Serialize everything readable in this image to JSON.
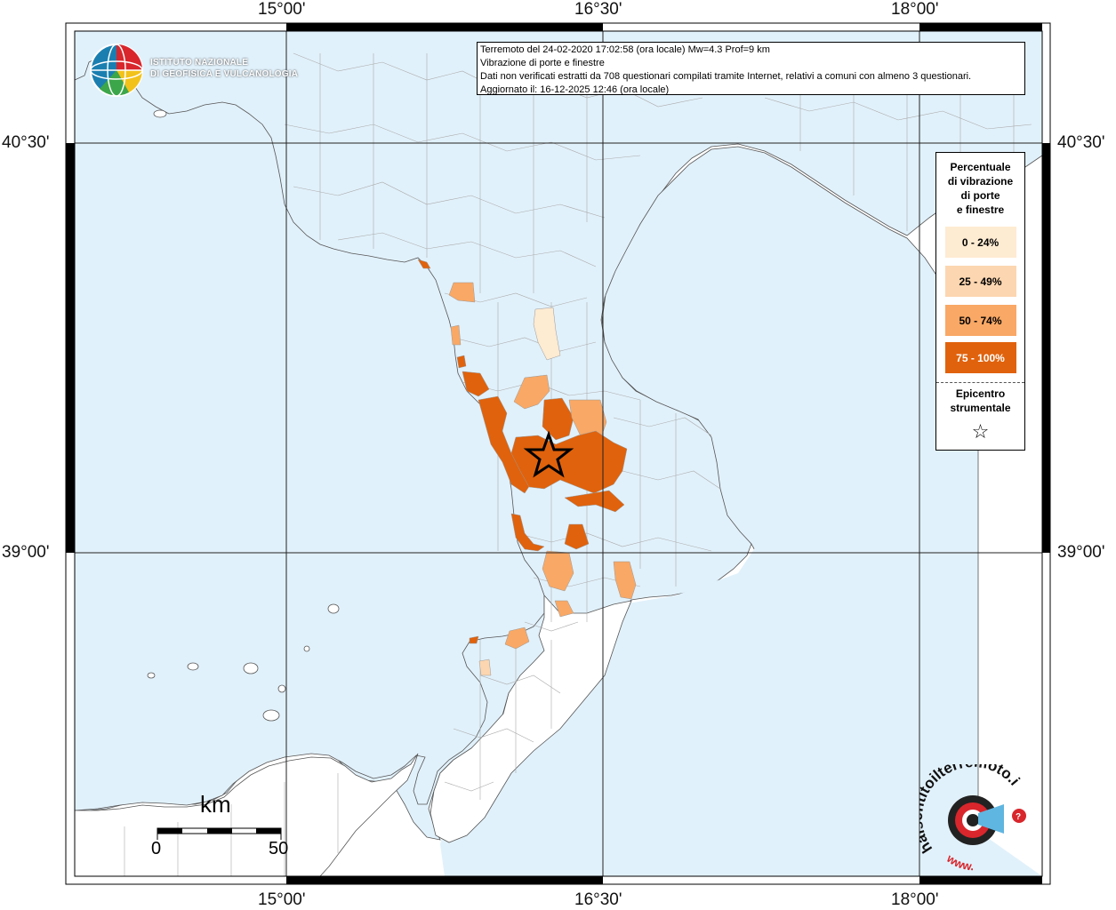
{
  "header": {
    "line1": "Terremoto del 24-02-2020 17:02:58 (ora locale) Mw=4.3 Prof=9 km",
    "line2": "Vibrazione di porte e finestre",
    "line3": "Dati non verificati estratti da 708 questionari compilati tramite Internet, relativi a comuni con almeno 3 questionari.",
    "line4": "Aggiornato il: 16-12-2025 12:46 (ora locale)"
  },
  "axes": {
    "lon_top": [
      "15°00'",
      "16°30'",
      "18°00'"
    ],
    "lon_bottom": [
      "15°00'",
      "16°30'",
      "18°00'"
    ],
    "lat_left": [
      "40°30'",
      "39°00'"
    ],
    "lat_right": [
      "40°30'",
      "39°00'"
    ]
  },
  "legend": {
    "title_lines": [
      "Percentuale",
      "di vibrazione",
      "di porte",
      "e finestre"
    ],
    "classes": [
      {
        "label": "0 - 24%",
        "color": "#fdebd2"
      },
      {
        "label": "25 - 49%",
        "color": "#fcd6b0"
      },
      {
        "label": "50 - 74%",
        "color": "#f9a865"
      },
      {
        "label": "75 - 100%",
        "color": "#e0620c"
      }
    ],
    "epicenter_title_lines": [
      "Epicentro",
      "strumentale"
    ],
    "epicenter_symbol": "☆"
  },
  "logo": {
    "ingv_line1": "ISTITUTO NAZIONALE",
    "ingv_line2": "DI GEOFISICA E VULCANOLOGIA",
    "hs_text": "haisentitoilterremoto.it",
    "hs_www": "www."
  },
  "scale": {
    "unit": "km",
    "min": "0",
    "max": "50"
  },
  "colors": {
    "sea": "#e1f1fb",
    "land": "#ffffff",
    "grid": "#222222"
  }
}
